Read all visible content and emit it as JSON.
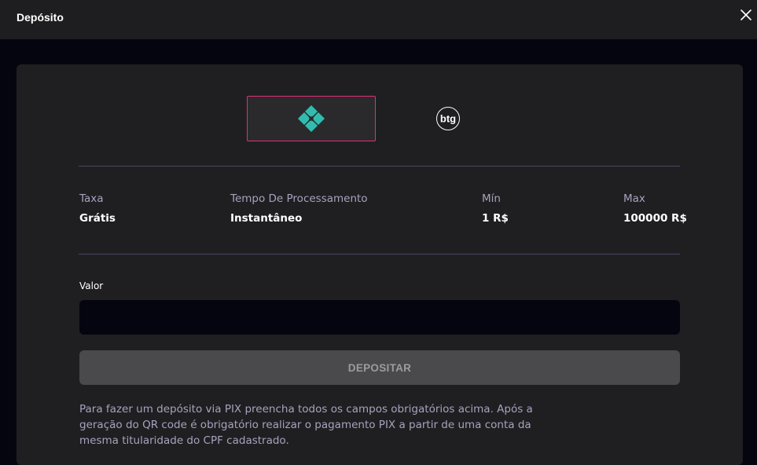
{
  "header": {
    "title": "Depósito",
    "close_icon": "close-icon"
  },
  "methods": [
    {
      "name": "PIX",
      "icon": "pix-icon",
      "selected": true,
      "color": "#32bcad"
    },
    {
      "name": "btg",
      "icon": "btg-icon",
      "selected": false
    }
  ],
  "btg_logo_text": "btg",
  "info": {
    "fee": {
      "label": "Taxa",
      "value": "Grátis"
    },
    "processing": {
      "label": "Tempo De Processamento",
      "value": "Instantâneo"
    },
    "min": {
      "label": "Mín",
      "value": "1 R$"
    },
    "max": {
      "label": "Max",
      "value": "100000 R$"
    }
  },
  "form": {
    "amount_label": "Valor",
    "amount_value": "",
    "deposit_label": "DEPOSITAR"
  },
  "note": "Para fazer um depósito via PIX preencha todos os campos obrigatórios acima. Após a geração do QR code é obrigatório realizar o pagamento PIX a partir de uma conta da mesma titularidade do CPF cadastrado.",
  "colors": {
    "accent_border": "#e0307a",
    "pix_green": "#32bcad",
    "background": "#05050f",
    "panel": "#1f1f21"
  }
}
